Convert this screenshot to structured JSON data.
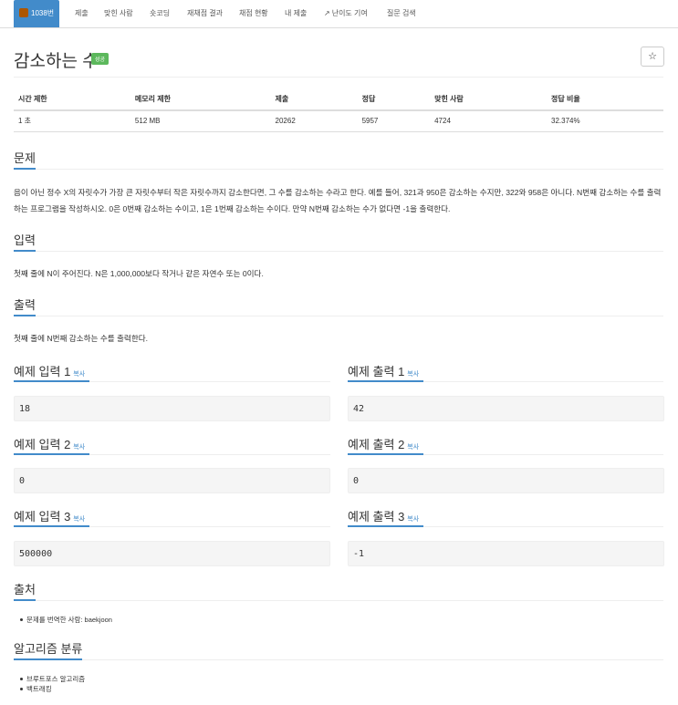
{
  "tabs": [
    {
      "label": "1038번",
      "active": true
    },
    {
      "label": "제출"
    },
    {
      "label": "맞힌 사람"
    },
    {
      "label": "숏코딩"
    },
    {
      "label": "재채점 결과"
    },
    {
      "label": "채점 현황"
    },
    {
      "label": "내 제출"
    },
    {
      "label": "난이도 기여",
      "icon": "external-link-icon"
    },
    {
      "label": "질문 검색"
    }
  ],
  "problem": {
    "title": "감소하는 수",
    "status": "성공",
    "star_icon": "☆"
  },
  "info_table": {
    "headers": [
      "시간 제한",
      "메모리 제한",
      "제출",
      "정답",
      "맞힌 사람",
      "정답 비율"
    ],
    "values": [
      "1 초",
      "512 MB",
      "20262",
      "5957",
      "4724",
      "32.374%"
    ]
  },
  "sections": {
    "description_title": "문제",
    "description_text": "음이 아닌 정수 X의 자릿수가 가장 큰 자릿수부터 작은 자릿수까지 감소한다면, 그 수를 감소하는 수라고 한다. 예를 들어, 321과 950은 감소하는 수지만, 322와 958은 아니다. N번째 감소하는 수를 출력하는 프로그램을 작성하시오. 0은 0번째 감소하는 수이고, 1은 1번째 감소하는 수이다. 만약 N번째 감소하는 수가 없다면 -1을 출력한다.",
    "input_title": "입력",
    "input_text": "첫째 줄에 N이 주어진다. N은 1,000,000보다 작거나 같은 자연수 또는 0이다.",
    "output_title": "출력",
    "output_text": "첫째 줄에 N번째 감소하는 수를 출력한다.",
    "source_title": "출처",
    "source_items": [
      "문제를 번역한 사람: baekjoon"
    ],
    "algorithm_title": "알고리즘 분류",
    "algorithm_items": [
      "브루트포스 알고리즘",
      "백트래킹"
    ]
  },
  "samples": {
    "copy_label": "복사",
    "items": [
      {
        "in_title": "예제 입력 1",
        "out_title": "예제 출력 1",
        "input": "18",
        "output": "42"
      },
      {
        "in_title": "예제 입력 2",
        "out_title": "예제 출력 2",
        "input": "0",
        "output": "0"
      },
      {
        "in_title": "예제 입력 3",
        "out_title": "예제 출력 3",
        "input": "500000",
        "output": "-1"
      }
    ]
  },
  "colors": {
    "accent": "#428bca",
    "success": "#5cb85c",
    "tier_badge": "#ad5600"
  }
}
